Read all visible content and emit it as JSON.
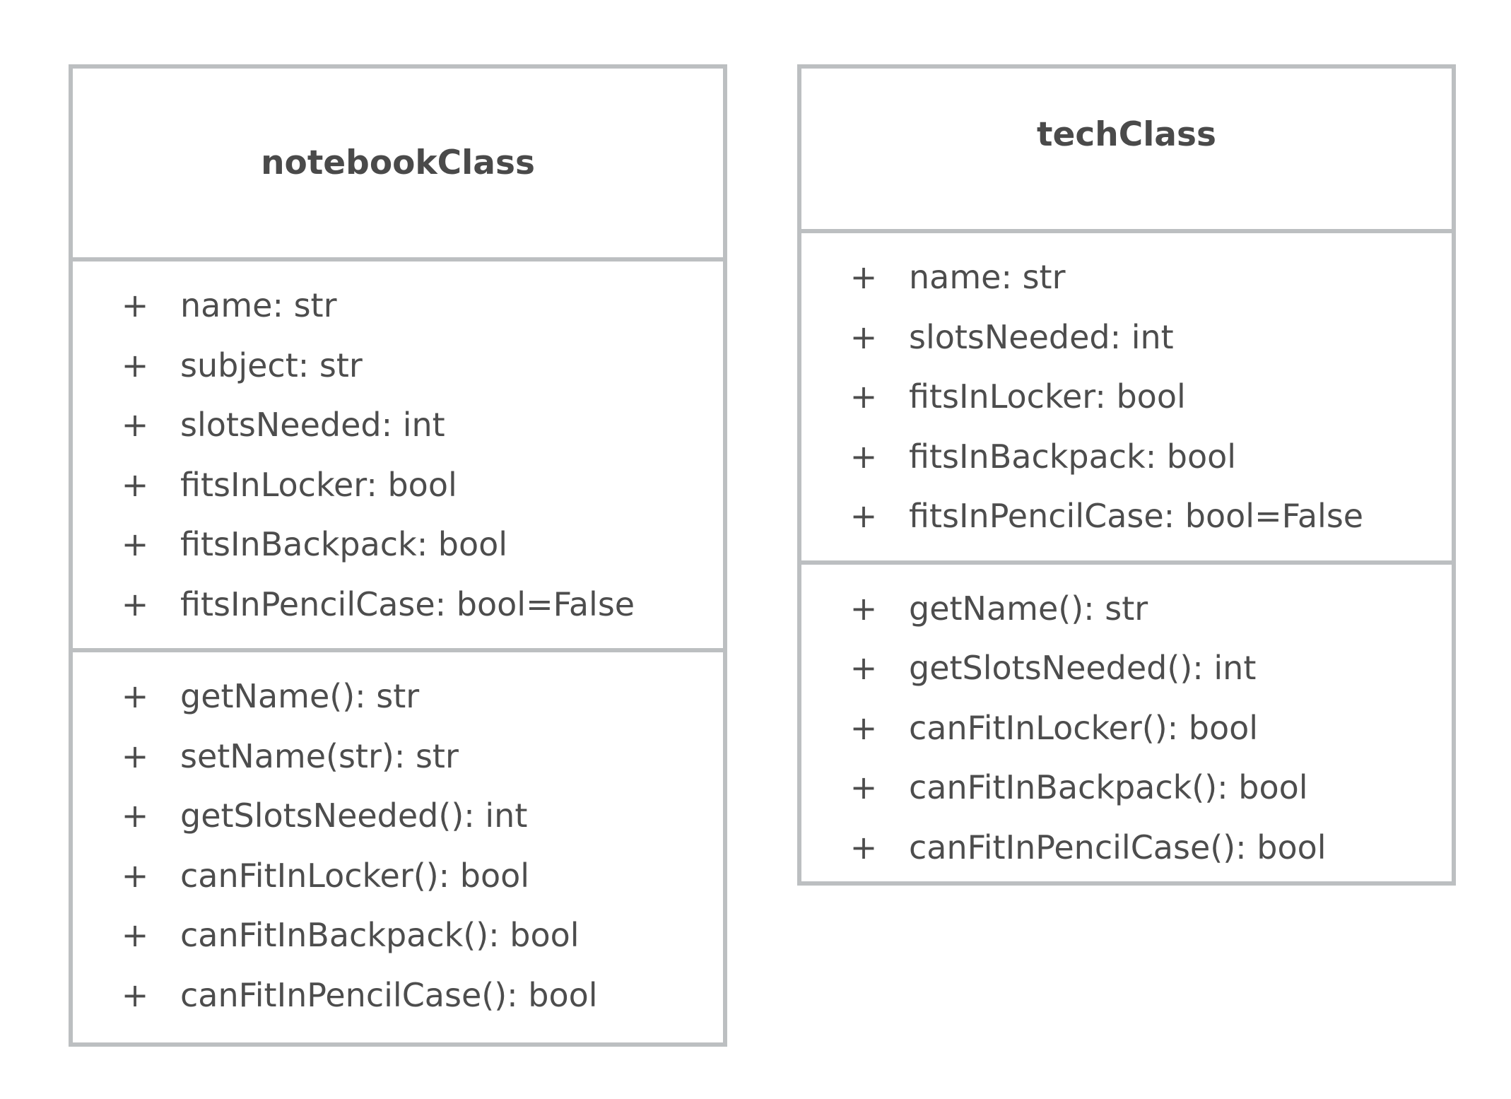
{
  "classes": [
    {
      "name": "notebookClass",
      "attributes": [
        {
          "visibility": "+",
          "text": "name: str"
        },
        {
          "visibility": "+",
          "text": "subject: str"
        },
        {
          "visibility": "+",
          "text": "slotsNeeded: int"
        },
        {
          "visibility": "+",
          "text": "fitsInLocker: bool"
        },
        {
          "visibility": "+",
          "text": "fitsInBackpack: bool"
        },
        {
          "visibility": "+",
          "text": "fitsInPencilCase: bool=False"
        }
      ],
      "methods": [
        {
          "visibility": "+",
          "text": "getName(): str"
        },
        {
          "visibility": "+",
          "text": "setName(str): str"
        },
        {
          "visibility": "+",
          "text": "getSlotsNeeded(): int"
        },
        {
          "visibility": "+",
          "text": "canFitInLocker(): bool"
        },
        {
          "visibility": "+",
          "text": "canFitInBackpack(): bool"
        },
        {
          "visibility": "+",
          "text": "canFitInPencilCase(): bool"
        }
      ]
    },
    {
      "name": "techClass",
      "attributes": [
        {
          "visibility": "+",
          "text": "name: str"
        },
        {
          "visibility": "+",
          "text": "slotsNeeded: int"
        },
        {
          "visibility": "+",
          "text": "fitsInLocker: bool"
        },
        {
          "visibility": "+",
          "text": "fitsInBackpack: bool"
        },
        {
          "visibility": "+",
          "text": "fitsInPencilCase: bool=False"
        }
      ],
      "methods": [
        {
          "visibility": "+",
          "text": "getName(): str"
        },
        {
          "visibility": "+",
          "text": "getSlotsNeeded(): int"
        },
        {
          "visibility": "+",
          "text": "canFitInLocker(): bool"
        },
        {
          "visibility": "+",
          "text": "canFitInBackpack(): bool"
        },
        {
          "visibility": "+",
          "text": "canFitInPencilCase(): bool"
        }
      ]
    }
  ],
  "colors": {
    "border": "#bcbfc1",
    "text": "#4d4d4d",
    "background": "#ffffff"
  }
}
